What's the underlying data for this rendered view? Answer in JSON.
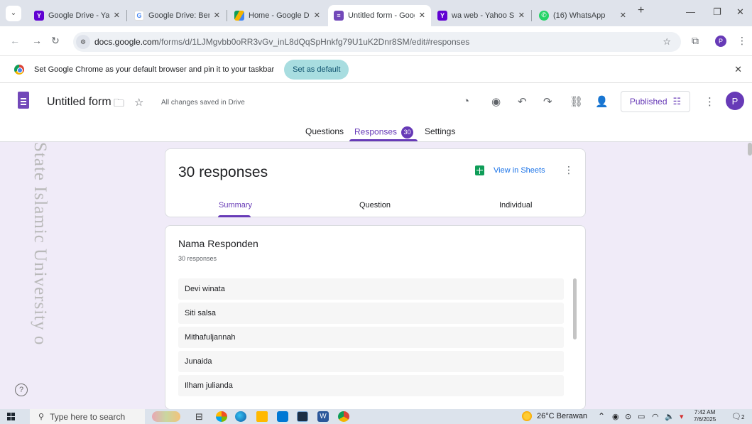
{
  "browser": {
    "tabs": [
      {
        "label": "Google Drive - Yahoo",
        "icon": "yahoo-icon",
        "active": false
      },
      {
        "label": "Google Drive: Berbag",
        "icon": "google-icon",
        "active": false
      },
      {
        "label": "Home - Google Drive",
        "icon": "drive-icon",
        "active": false
      },
      {
        "label": "Untitled form - Goog",
        "icon": "forms-icon",
        "active": true
      },
      {
        "label": "wa web - Yahoo Sear",
        "icon": "yahoo-icon",
        "active": false
      },
      {
        "label": "(16) WhatsApp",
        "icon": "whatsapp-icon",
        "active": false
      }
    ],
    "url_host": "docs.google.com",
    "url_path": "/forms/d/1LJMgvbb0oRR3vGv_inL8dQqSpHnkfg79U1uK2Dnr8SM/edit#responses"
  },
  "infobar": {
    "message": "Set Google Chrome as your default browser and pin it to your taskbar",
    "button": "Set as default"
  },
  "form_header": {
    "title": "Untitled form",
    "saved_status": "All changes saved in Drive",
    "published_label": "Published",
    "avatar_letter": "P",
    "tabs": {
      "questions": "Questions",
      "responses": "Responses",
      "responses_badge": "30",
      "settings": "Settings"
    }
  },
  "summary_card": {
    "response_count": "30 responses",
    "view_in_sheets": "View in Sheets",
    "subtabs": {
      "summary": "Summary",
      "question": "Question",
      "individual": "Individual"
    }
  },
  "question_card": {
    "title": "Nama Responden",
    "subtitle": "30 responses",
    "answers": [
      "Devi winata",
      "Siti salsa",
      "Mithafuljannah",
      "Junaida",
      "Ilham julianda"
    ]
  },
  "watermark": {
    "text": "State Islamic University o"
  },
  "taskbar": {
    "search_placeholder": "Type here to search",
    "weather": "26°C  Berawan",
    "time": "7:42 AM",
    "date": "7/6/2025",
    "notification_count": "2"
  },
  "colors": {
    "forms_purple": "#673ab7",
    "page_background": "#f0ebf8",
    "sheets_green": "#0f9d58",
    "link_blue": "#1a73e8"
  }
}
